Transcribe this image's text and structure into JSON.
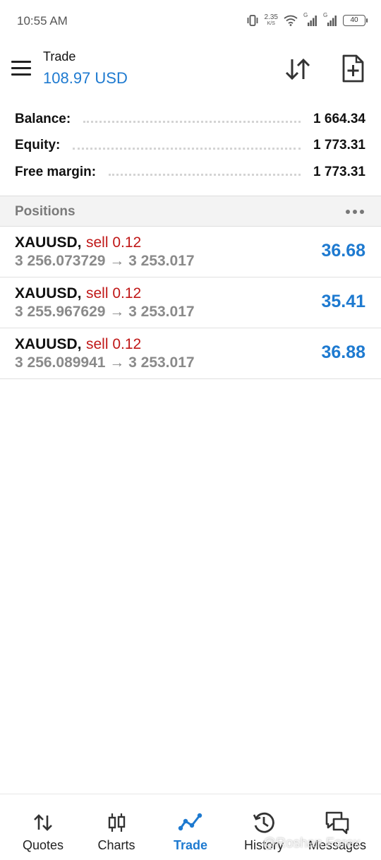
{
  "status_bar": {
    "time": "10:55 AM",
    "net_rate": "2.35",
    "net_unit": "K/S",
    "signal_1_label": "G",
    "signal_2_label": "G",
    "battery": "40",
    "icons": [
      "vibrate-icon",
      "wifi-icon",
      "signal-icon",
      "signal-icon",
      "battery-icon"
    ]
  },
  "header": {
    "title": "Trade",
    "subtitle": "108.97 USD"
  },
  "summary": [
    {
      "label": "Balance:",
      "value": "1 664.34"
    },
    {
      "label": "Equity:",
      "value": "1 773.31"
    },
    {
      "label": "Free margin:",
      "value": "1 773.31"
    }
  ],
  "positions": {
    "title": "Positions",
    "items": [
      {
        "symbol": "XAUUSD,",
        "side": "sell 0.12",
        "prices": "3 256.073729 → 3 253.017",
        "profit": "36.68"
      },
      {
        "symbol": "XAUUSD,",
        "side": "sell 0.12",
        "prices": "3 255.967629 → 3 253.017",
        "profit": "35.41"
      },
      {
        "symbol": "XAUUSD,",
        "side": "sell 0.12",
        "prices": "3 256.089941 → 3 253.017",
        "profit": "36.88"
      }
    ]
  },
  "bottom_nav": [
    {
      "label": "Quotes",
      "icon": "quotes-icon",
      "active": false
    },
    {
      "label": "Charts",
      "icon": "candlestick-chart-icon",
      "active": false
    },
    {
      "label": "Trade",
      "icon": "trade-trend-icon",
      "active": true
    },
    {
      "label": "History",
      "icon": "history-icon",
      "active": false
    },
    {
      "label": "Messages",
      "icon": "messages-icon",
      "active": false
    }
  ],
  "watermark": "@Roshan Forex",
  "colors": {
    "accent_blue": "#1e7ad0",
    "sell_red": "#c01818",
    "muted_gray": "#8a8a8a"
  }
}
